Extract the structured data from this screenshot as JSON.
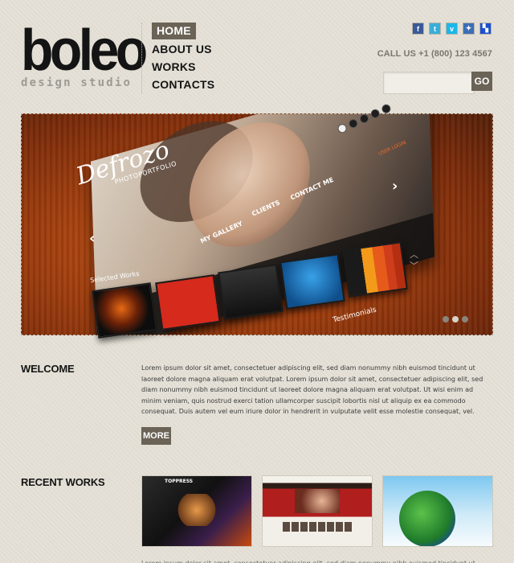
{
  "logo": {
    "main": "boleo",
    "sub": "design studio"
  },
  "nav": {
    "items": [
      "HOME",
      "ABOUT US",
      "WORKS",
      "CONTACTS"
    ]
  },
  "social": [
    {
      "icon": "facebook-icon",
      "glyph": "f",
      "color": "#3b5998"
    },
    {
      "icon": "twitter-icon",
      "glyph": "t",
      "color": "#3aaeda"
    },
    {
      "icon": "vimeo-icon",
      "glyph": "v",
      "color": "#1ab7ea"
    },
    {
      "icon": "flickr-icon",
      "glyph": "✦",
      "color": "#3b6fb6"
    },
    {
      "icon": "delicious-icon",
      "glyph": "▚",
      "color": "#1b4fcf"
    }
  ],
  "header": {
    "call": "CALL US +1 (800) 123 4567"
  },
  "search": {
    "placeholder": "",
    "button": "GO"
  },
  "slider": {
    "brand": "Defrozo",
    "brand_sub": "PHOTOPORTFOLIO",
    "menu": [
      "MY GALLERY",
      "CLIENTS",
      "CONTACT ME"
    ],
    "user_login": "USER LOGIN",
    "selected_works": "Selected Works",
    "testimonials": "Testimonials"
  },
  "welcome": {
    "heading": "WELCOME",
    "text": "Lorem ipsum dolor sit amet, consectetuer adipiscing elit, sed diam nonummy nibh euismod tincidunt ut laoreet dolore magna aliquam erat volutpat. Lorem ipsum dolor sit amet, consectetuer adipiscing elit, sed diam nonummy nibh euismod tincidunt ut laoreet dolore magna aliquam erat volutpat. Ut wisi enim ad minim veniam, quis nostrud exerci tation ullamcorper suscipit lobortis nisl ut aliquip ex ea commodo consequat. Duis autem vel eum iriure dolor in hendrerit in vulputate velit esse molestie consequat, vel.",
    "more": "MORE"
  },
  "recent": {
    "heading": "RECENT WORKS",
    "work1_title": "TOPPRESS"
  },
  "footer": {
    "text": "Lorem ipsum dolor sit amet, consectetuer adipiscing elit, sed diam nonummy nibh euismod tincidunt ut laoreet"
  }
}
